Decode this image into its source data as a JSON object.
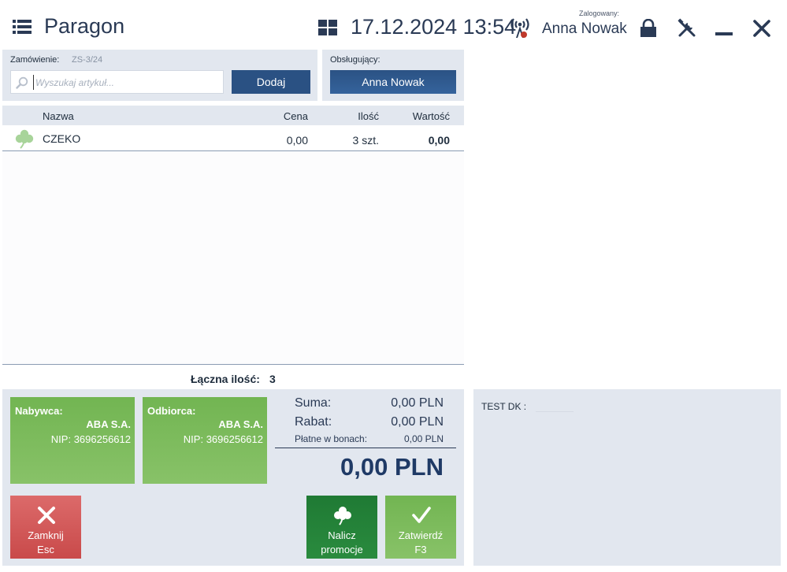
{
  "header": {
    "title": "Paragon",
    "datetime": "17.12.2024 13:54",
    "logged_label": "Zalogowany:",
    "logged_user": "Anna Nowak",
    "icons": [
      "menu-icon",
      "grid-icon",
      "signal-icon",
      "lock-icon",
      "tools-icon",
      "minimize-icon",
      "close-icon"
    ],
    "signal_alert_color": "#c0392b"
  },
  "order": {
    "label": "Zamówienie:",
    "number": "ZS-3/24",
    "search_placeholder": "Wyszukaj artykuł...",
    "search_value": "",
    "add_label": "Dodaj"
  },
  "cashier": {
    "label": "Obsługujący:",
    "name": "Anna Nowak"
  },
  "table": {
    "columns": [
      "Nazwa",
      "Cena",
      "Ilość",
      "Wartość"
    ],
    "rows": [
      {
        "icon": "clover-icon",
        "name": "CZEKO",
        "price": "0,00",
        "qty": "3 szt.",
        "value": "0,00"
      }
    ]
  },
  "totals": {
    "qty_label": "Łączna ilość:",
    "qty_value": "3",
    "sum_label": "Suma:",
    "sum_value": "0,00 PLN",
    "discount_label": "Rabat:",
    "discount_value": "0,00 PLN",
    "vouchers_label": "Płatne w bonach:",
    "vouchers_value": "0,00 PLN",
    "grand_total": "0,00 PLN"
  },
  "buyer": {
    "title": "Nabywca:",
    "name": "ABA S.A.",
    "nip": "NIP: 3696256612"
  },
  "recipient": {
    "title": "Odbiorca:",
    "name": "ABA S.A.",
    "nip": "NIP: 3696256612"
  },
  "actions": {
    "close_line1": "Zamknij",
    "close_line2": "Esc",
    "promo_line1": "Nalicz",
    "promo_line2": "promocje",
    "confirm_line1": "Zatwierdź",
    "confirm_line2": "F3"
  },
  "side": {
    "test_label": "TEST DK :",
    "test_value": ""
  },
  "colors": {
    "accent_blue": "#2a5183",
    "green": "#7bbb5a",
    "dark_green": "#1f7a34",
    "red": "#d35a5a",
    "panel": "#e2e7ef"
  }
}
